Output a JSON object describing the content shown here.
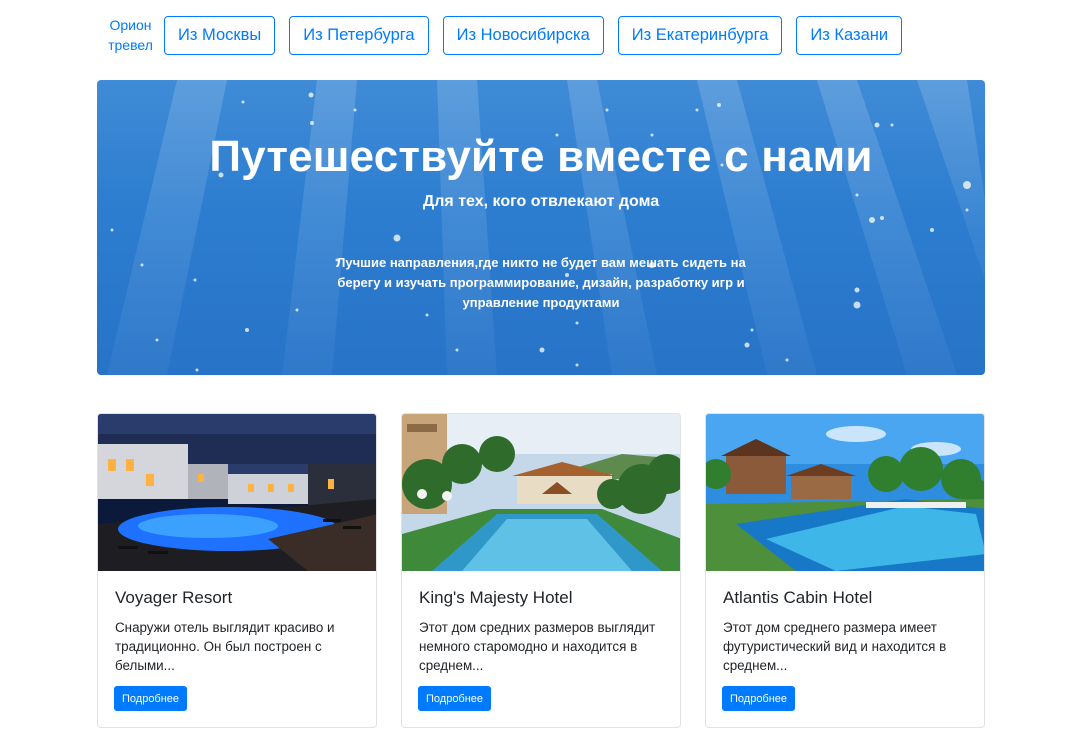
{
  "nav": {
    "brand": "Орион тревел",
    "cities": [
      "Из Москвы",
      "Из Петербурга",
      "Из Новосибирска",
      "Из Екатеринбурга",
      "Из Казани"
    ]
  },
  "hero": {
    "title": "Путешествуйте вместе с нами",
    "subtitle": "Для тех, кого отвлекают дома",
    "description": "Лучшие направления,где никто не будет вам мешать сидеть на берегу и изучать программирование, дизайн, разработку игр и управление продуктами"
  },
  "cards": [
    {
      "title": "Voyager Resort",
      "text": "Снаружи отель выглядит красиво и традиционно. Он был построен с белыми...",
      "button": "Подробнее"
    },
    {
      "title": "King's Majesty Hotel",
      "text": "Этот дом средних размеров выглядит немного старомодно и находится в среднем...",
      "button": "Подробнее"
    },
    {
      "title": "Atlantis Cabin Hotel",
      "text": "Этот дом среднего размера имеет футуристический вид и находится в среднем...",
      "button": "Подробнее"
    }
  ],
  "colors": {
    "primary": "#007bff",
    "hero_blue": "#2c7dd0"
  }
}
